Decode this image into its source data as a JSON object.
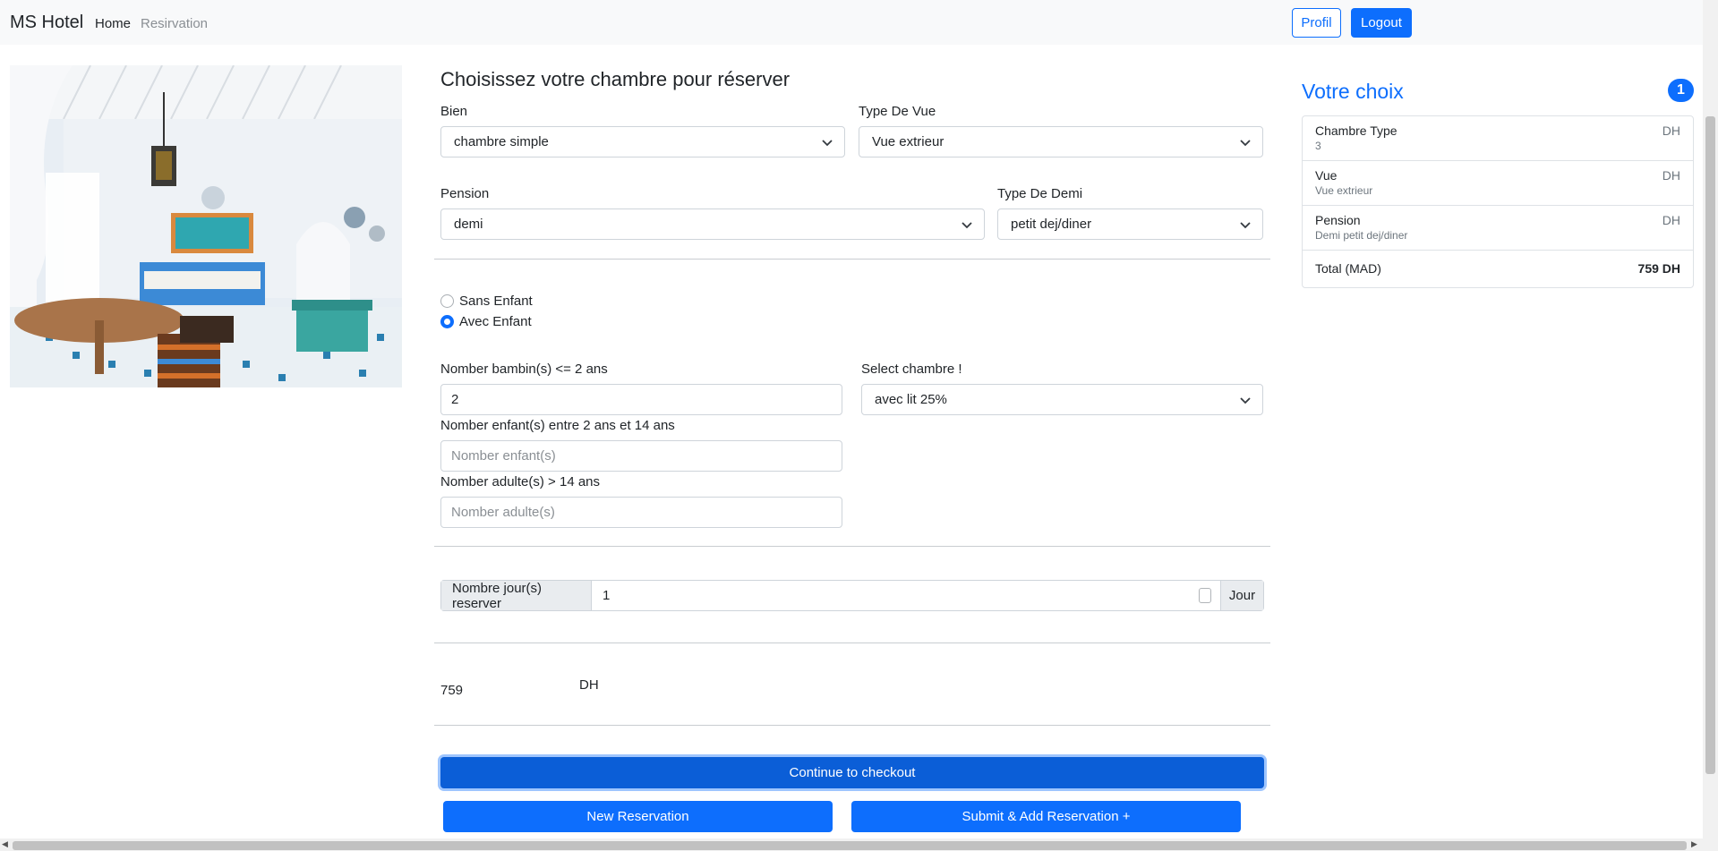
{
  "navbar": {
    "brand": "MS Hotel",
    "links": [
      "Home",
      "Resirvation"
    ],
    "profil_label": "Profil",
    "logout_label": "Logout"
  },
  "form": {
    "title": "Choisissez votre chambre pour réserver",
    "bien": {
      "label": "Bien",
      "value": "chambre simple"
    },
    "type_vue": {
      "label": "Type De Vue",
      "value": "Vue extrieur"
    },
    "pension": {
      "label": "Pension",
      "value": "demi"
    },
    "type_demi": {
      "label": "Type De Demi",
      "value": "petit dej/diner"
    },
    "radios": [
      {
        "label": "Sans Enfant",
        "checked": false
      },
      {
        "label": "Avec Enfant",
        "checked": true
      }
    ],
    "bambin": {
      "label": "Nomber bambin(s) <= 2 ans",
      "value": "2"
    },
    "select_chambre": {
      "label": "Select chambre !",
      "value": "avec lit 25%"
    },
    "enfant": {
      "label": "Nomber enfant(s) entre 2 ans et 14 ans",
      "placeholder": "Nomber  enfant(s)"
    },
    "adulte": {
      "label": "Nomber adulte(s) > 14 ans",
      "placeholder": "Nomber  adulte(s)"
    },
    "jours": {
      "prefix": "Nombre jour(s) reserver",
      "value": "1",
      "suffix": "Jour"
    },
    "total_value": "759",
    "total_unit": "DH",
    "checkout_label": "Continue to checkout",
    "new_label": "New Reservation",
    "submit_label": "Submit & Add Reservation +"
  },
  "sidebar": {
    "title": "Votre choix",
    "badge": "1",
    "items": [
      {
        "heading": "Chambre Type",
        "sub": "3",
        "right": "DH"
      },
      {
        "heading": "Vue",
        "sub": "Vue extrieur",
        "right": "DH"
      },
      {
        "heading": "Pension",
        "sub": "Demi petit dej/diner",
        "right": "DH"
      }
    ],
    "total": {
      "label": "Total (MAD)",
      "value": "759 DH"
    }
  },
  "colors": {
    "primary": "#0d6efd",
    "navbar_bg": "#f8f9fa"
  }
}
